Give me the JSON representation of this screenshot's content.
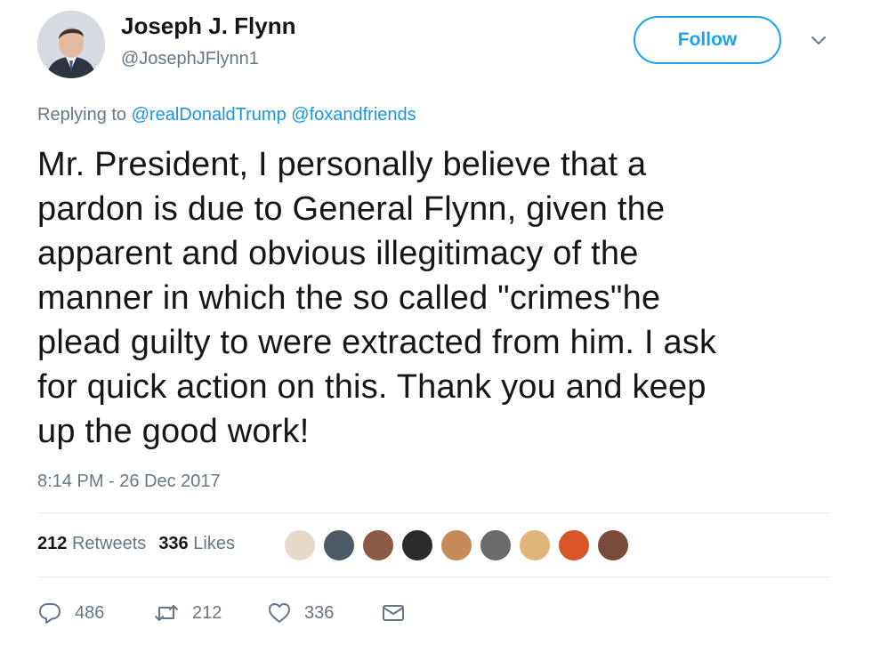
{
  "author": {
    "name": "Joseph J. Flynn",
    "handle": "@JosephJFlynn1",
    "avatar_icon": "profile-photo"
  },
  "follow_label": "Follow",
  "reply": {
    "prefix": "Replying to",
    "mention1": "@realDonaldTrump",
    "mention2": "@foxandfriends"
  },
  "tweet_text": "Mr. President, I  personally believe that a\npardon is due to General Flynn, given the\napparent and obvious illegitimacy of the\nmanner in which the so called \"crimes\"he\nplead guilty to were extracted from him.  I ask\nfor quick action on this.  Thank you and keep\nup the good work!",
  "timestamp": "8:14 PM - 26 Dec 2017",
  "stats": {
    "retweets_count": "212",
    "retweets_label": "Retweets",
    "likes_count": "336",
    "likes_label": "Likes"
  },
  "likers_colors": [
    "#e8d9c8",
    "#4b5a66",
    "#8a5a44",
    "#2a2a2a",
    "#c48a5a",
    "#6b6b6b",
    "#e0b57a",
    "#d8552a",
    "#7a4a3a"
  ],
  "actions": {
    "reply_count": "486",
    "retweet_count": "212",
    "like_count": "336"
  },
  "colors": {
    "accent": "#1da1f2",
    "secondary_text": "#657786"
  }
}
